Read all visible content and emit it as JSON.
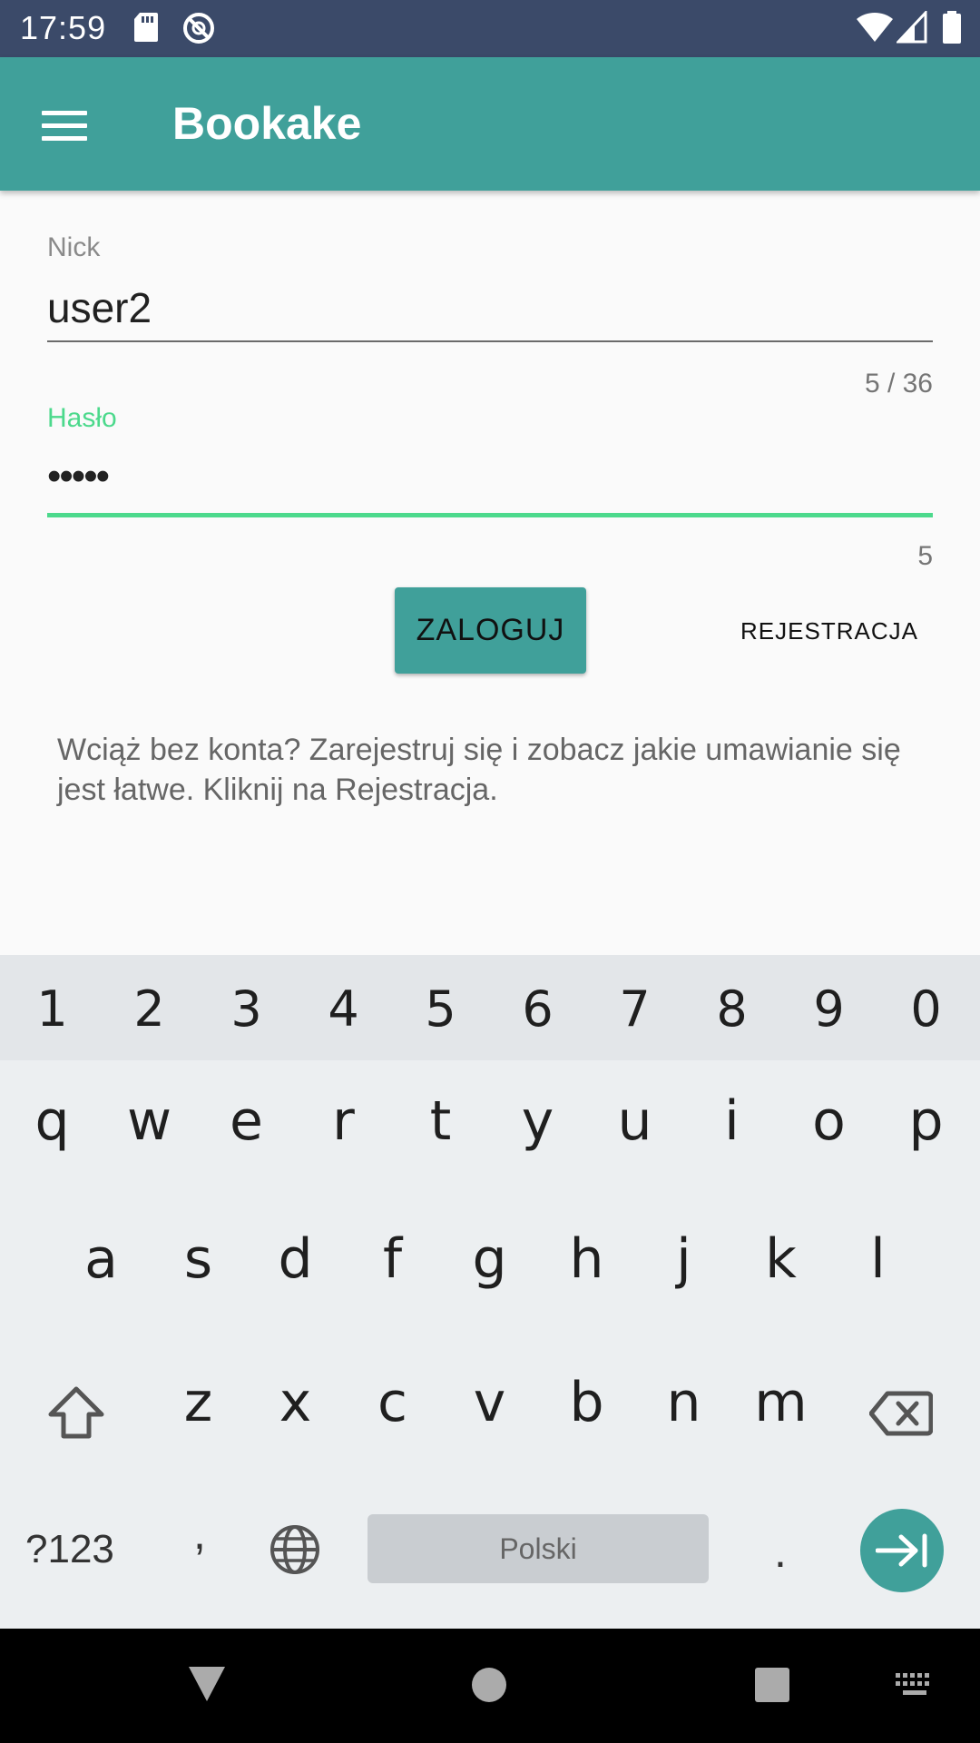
{
  "status_bar": {
    "time": "17:59",
    "icons": [
      "sd-card-icon",
      "do-not-disturb-icon",
      "wifi-icon",
      "signal-icon",
      "battery-icon"
    ]
  },
  "app_bar": {
    "title": "Bookake",
    "menu_icon": "hamburger-menu-icon"
  },
  "colors": {
    "status_bar": "#3b4a69",
    "primary": "#40a09a",
    "focused_field": "#4cd98c"
  },
  "login_form": {
    "nick": {
      "label": "Nick",
      "value": "user2",
      "counter": "5 / 36"
    },
    "password": {
      "label": "Hasło",
      "value": "•••••",
      "counter": "5"
    },
    "login_button": "ZALOGUJ",
    "register_button": "REJESTRACJA",
    "info_text": "Wciąż bez konta? Zarejestruj się i zobacz jakie umawianie się jest łatwe. Kliknij na Rejestracja."
  },
  "keyboard": {
    "number_row": [
      "1",
      "2",
      "3",
      "4",
      "5",
      "6",
      "7",
      "8",
      "9",
      "0"
    ],
    "row_q": [
      "q",
      "w",
      "e",
      "r",
      "t",
      "y",
      "u",
      "i",
      "o",
      "p"
    ],
    "row_a": [
      "a",
      "s",
      "d",
      "f",
      "g",
      "h",
      "j",
      "k",
      "l"
    ],
    "row_z": [
      "z",
      "x",
      "c",
      "v",
      "b",
      "n",
      "m"
    ],
    "symbols_key": "?123",
    "comma_key": ",",
    "space_label": "Polski",
    "period_key": ".",
    "icons": [
      "shift-icon",
      "backspace-icon",
      "globe-icon",
      "enter-icon"
    ]
  },
  "nav_bar": {
    "icons": [
      "back-icon",
      "home-icon",
      "recents-icon",
      "keyboard-icon"
    ]
  }
}
